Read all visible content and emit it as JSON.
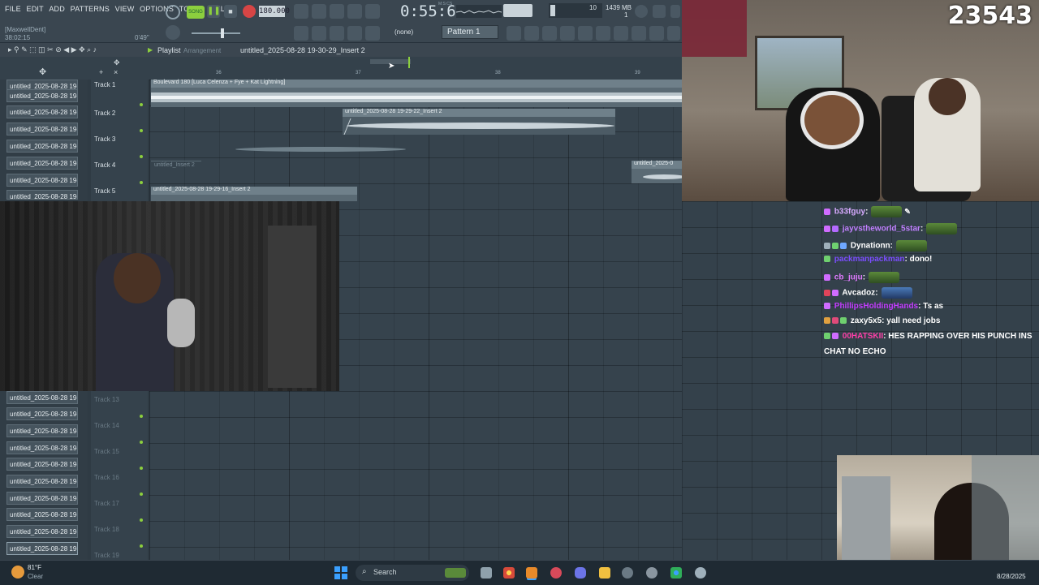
{
  "app": {
    "menu": [
      "FILE",
      "EDIT",
      "ADD",
      "PATTERNS",
      "VIEW",
      "OPTIONS",
      "TOOLS",
      "HELP"
    ],
    "hint_user": "[MaxwellDent]",
    "hint_time": "38:02:15",
    "hint_pos": "0'49\"",
    "song_label": "SONG",
    "tempo": "180.000",
    "time": "0:55:66",
    "time_sub": "M:S:CS",
    "cpu_val": "10",
    "mem": "1439 MB",
    "mem_sub": "1",
    "none_label": "(none)",
    "pattern": "Pattern 1"
  },
  "playlist": {
    "title": "Playlist",
    "subtitle": "Arrangement",
    "insert_path": "untitled_2025-08-28 19-30-29_Insert 2",
    "ruler": [
      "36",
      "37",
      "38",
      "39"
    ],
    "tracks_top": [
      "Track 1",
      "Track 2",
      "Track 3",
      "Track 4",
      "Track 5"
    ],
    "tracks_bottom": [
      "Track 13",
      "Track 14",
      "Track 15",
      "Track 16",
      "Track 17",
      "Track 18",
      "Track 19"
    ],
    "clips": {
      "c1": "Boulevard 180 [Luca Celenza + Fye + Kat Lightning]",
      "c2": "untitled_2025-08-28 19-29-22_Insert 2",
      "c4a": "untitled_Insert 2",
      "c4b": "untitled_2025-0",
      "c5": "untitled_2025-08-28 19-29-16_Insert 2"
    }
  },
  "sidebar": {
    "items_top": [
      "untitled_2025-08-28 19-",
      "untitled_2025-08-28 19-",
      "untitled_2025-08-28 19-",
      "untitled_2025-08-28 19-",
      "untitled_2025-08-28 19-",
      "untitled_2025-08-28 19-",
      "untitled_2025-08-28 19-",
      "untitled_2025-08-28 19-"
    ],
    "items_bottom": [
      "untitled_2025-08-28 19-",
      "untitled_2025-08-28 19-",
      "untitled_2025-08-28 19-",
      "untitled_2025-08-28 19-",
      "untitled_2025-08-28 19-",
      "untitled_2025-08-28 19-",
      "untitled_2025-08-28 19-",
      "untitled_2025-08-28 19-",
      "untitled_2025-08-28 19-",
      "untitled_2025-08-28 19-"
    ]
  },
  "stream": {
    "viewer_count": "23543"
  },
  "chat": [
    {
      "user": "b33fguy",
      "color": "#d7aaff",
      "text": "",
      "emote": true
    },
    {
      "user": "jayvstheworld_5star",
      "color": "#c080ff",
      "text": "",
      "emote": true
    },
    {
      "user": "Dynationn",
      "color": "#ffffff",
      "text": "",
      "emote": true
    },
    {
      "user": "packmanpackman",
      "color": "#7b4dff",
      "text": "dono!",
      "emote": false
    },
    {
      "user": "cb_juju",
      "color": "#e07aff",
      "text": "",
      "emote": true
    },
    {
      "user": "Avcadoz",
      "color": "#ffffff",
      "text": "",
      "emote": true
    },
    {
      "user": "PhillipsHoldingHands",
      "color": "#c43cff",
      "text": "Ts as",
      "emote": false
    },
    {
      "user": "zaxy5x5",
      "color": "#ffffff",
      "text": "yall need jobs",
      "emote": false
    },
    {
      "user": "00HATSKII",
      "color": "#ff3fa8",
      "text": "HES RAPPING OVER HIS PUNCH INS",
      "emote": false
    },
    {
      "user": "",
      "color": "#ffffff",
      "text": "CHAT NO ECHO",
      "emote": false
    }
  ],
  "taskbar": {
    "weather_temp": "81°F",
    "weather_desc": "Clear",
    "search": "Search",
    "date": "8/28/2025"
  }
}
